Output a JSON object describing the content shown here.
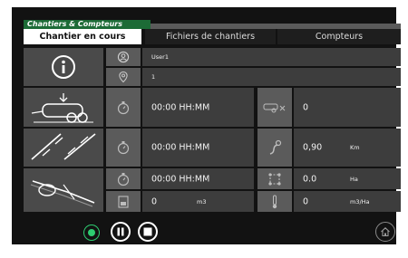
{
  "header": {
    "breadcrumb": "Chantiers & Compteurs",
    "tabs": [
      "Chantier en cours",
      "Fichiers de chantiers",
      "Compteurs"
    ]
  },
  "info": {
    "user": "User1",
    "location": "1"
  },
  "rows": [
    {
      "time": "00:00 HH:MM",
      "right_value": "0",
      "right_unit": ""
    },
    {
      "time": "00:00 HH:MM",
      "right_value": "0,90",
      "right_unit": "Km"
    },
    {
      "time": "00:00 HH:MM",
      "right_value": "0.0",
      "right_unit": "Ha"
    }
  ],
  "volume": {
    "value": "0",
    "unit": "m3",
    "rate_value": "0",
    "rate_unit": "m3/Ha"
  },
  "colors": {
    "accent": "#1c6b36",
    "record": "#2ecc71"
  },
  "icons": [
    "info-icon",
    "user-icon",
    "location-pin-icon",
    "slurry-tanker-icon",
    "road-icon",
    "spreader-icon",
    "stopwatch-icon",
    "trailer-count-icon",
    "distance-icon",
    "area-icon",
    "tank-icon",
    "flow-rate-icon",
    "record-icon",
    "pause-icon",
    "stop-icon",
    "home-icon"
  ]
}
